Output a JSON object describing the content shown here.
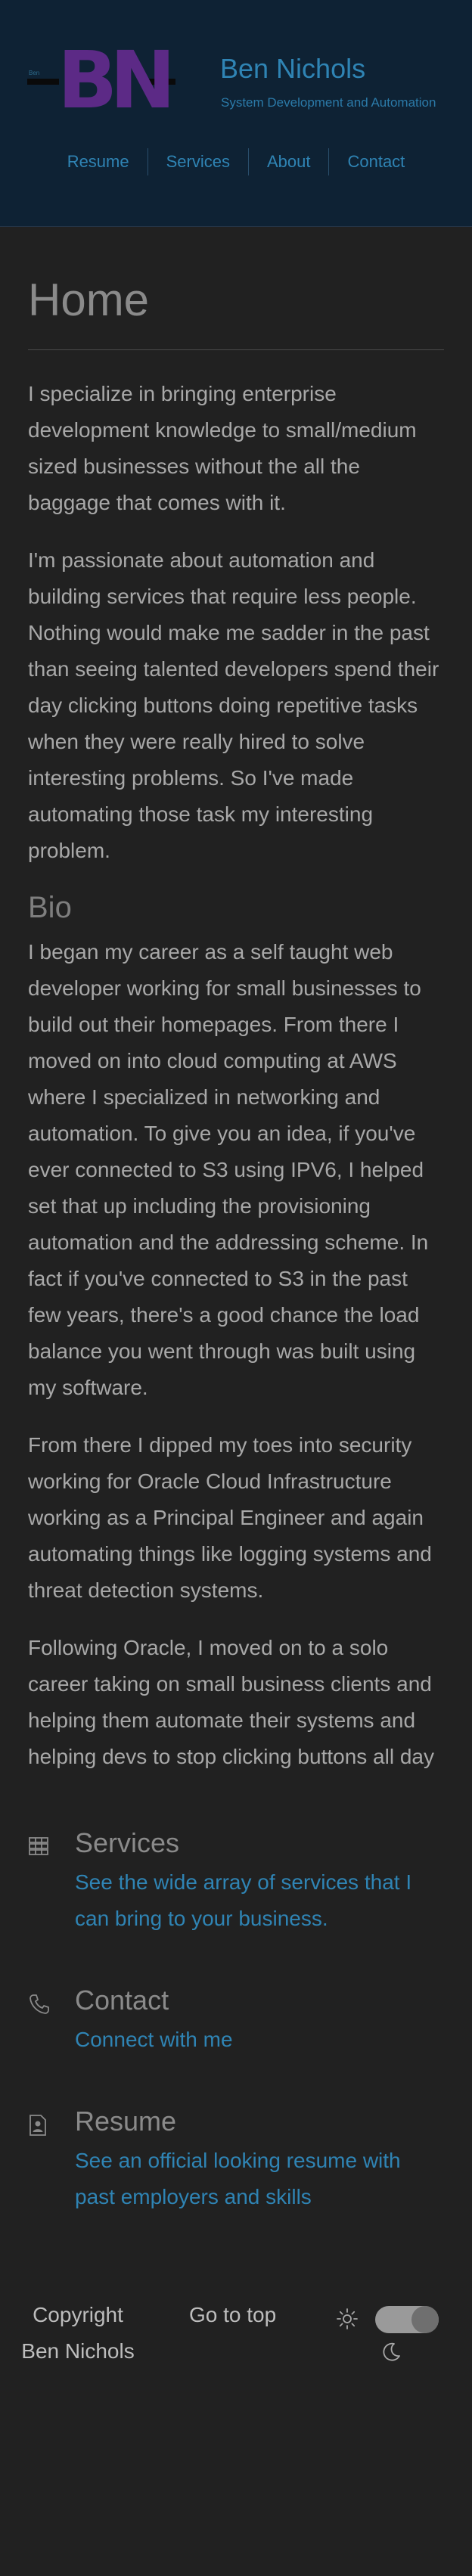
{
  "header": {
    "logo": {
      "monogram": "BN",
      "left_small": "Ben",
      "right_small": "Nichols"
    },
    "name": "Ben Nichols",
    "tagline": "System Development and Automation",
    "nav": [
      {
        "label": "Resume"
      },
      {
        "label": "Services"
      },
      {
        "label": "About"
      },
      {
        "label": "Contact"
      }
    ]
  },
  "main": {
    "title": "Home",
    "intro": [
      "I specialize in bringing enterprise development knowledge to small/medium sized businesses without the all the baggage that comes with it.",
      "I'm passionate about automation and building services that require less people. Nothing would make me sadder in the past than seeing talented developers spend their day clicking buttons doing repetitive tasks when they were really hired to solve interesting problems. So I've made automating those task my interesting problem."
    ],
    "bio": {
      "heading": "Bio",
      "paragraphs": [
        "I began my career as a self taught web developer working for small businesses to build out their homepages. From there I moved on into cloud computing at AWS where I specialized in networking and automation. To give you an idea, if you've ever connected to S3 using IPV6, I helped set that up including the provisioning automation and the addressing scheme. In fact if you've connected to S3 in the past few years, there's a good chance the load balance you went through was built using my software.",
        "From there I dipped my toes into security working for Oracle Cloud Infrastructure working as a Principal Engineer and again automating things like logging systems and threat detection systems.",
        "Following Oracle, I moved on to a solo career taking on small business clients and helping them automate their systems and helping devs to stop clicking buttons all day"
      ]
    },
    "cards": [
      {
        "icon": "grid-icon",
        "title": "Services",
        "link": "See the wide array of services that I can bring to your business."
      },
      {
        "icon": "phone-icon",
        "title": "Contact",
        "link": "Connect with me"
      },
      {
        "icon": "resume-icon",
        "title": "Resume",
        "link": "See an official looking resume with past employers and skills"
      }
    ]
  },
  "footer": {
    "copyright": "Copyright Ben Nichols",
    "go_top": "Go to top",
    "theme_icons": [
      "sun-icon",
      "moon-icon"
    ],
    "theme_toggle_state": "dark"
  },
  "colors": {
    "header_bg": "#0e2234",
    "page_bg": "#212121",
    "accent": "#2f84b4",
    "logo": "#5c2a86"
  }
}
